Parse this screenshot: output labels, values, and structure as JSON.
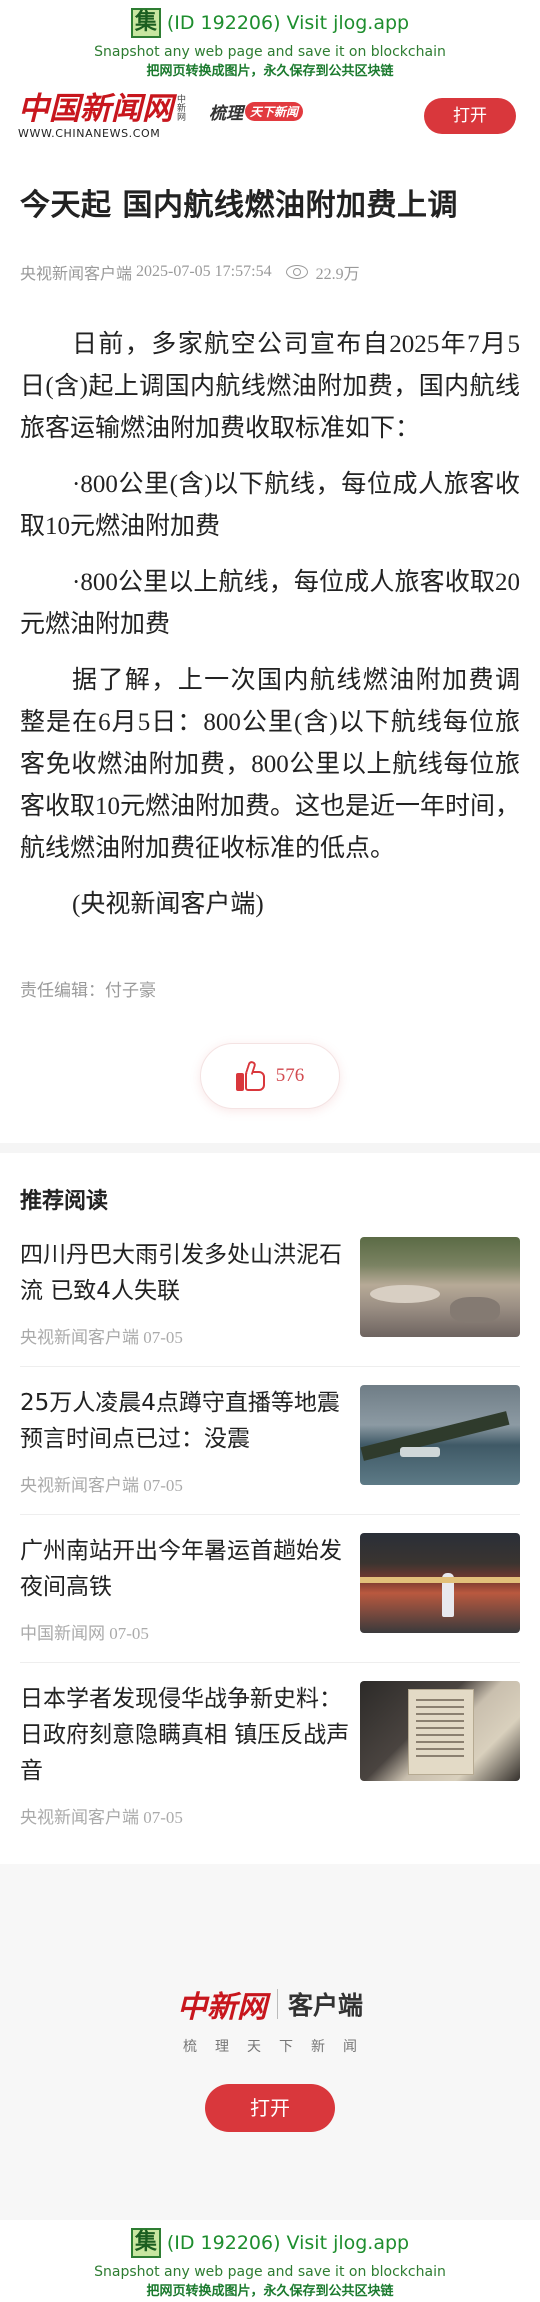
{
  "watermark": {
    "logo_char": "集",
    "id_text": "(ID 192206) Visit jlog.app",
    "line_en": "Snapshot any web page and save it on blockchain",
    "line_cn": "把网页转换成图片，永久保存到公共区块链"
  },
  "header": {
    "brand_cn": "中国新闻网",
    "brand_small": "中新网",
    "brand_url": "WWW.CHINANEWS.COM",
    "slogan_a": "梳理",
    "slogan_b": "天下新闻",
    "open_button": "打开"
  },
  "article": {
    "title": "今天起 国内航线燃油附加费上调",
    "source": "央视新闻客户端",
    "time": "2025-07-05 17:57:54",
    "views": "22.9万",
    "paragraphs": [
      "日前，多家航空公司宣布自2025年7月5日(含)起上调国内航线燃油附加费，国内航线旅客运输燃油附加费收取标准如下：",
      "·800公里(含)以下航线，每位成人旅客收取10元燃油附加费",
      "·800公里以上航线，每位成人旅客收取20元燃油附加费",
      "据了解，上一次国内航线燃油附加费调整是在6月5日：800公里(含)以下航线每位旅客免收燃油附加费，800公里以上航线每位旅客收取10元燃油附加费。这也是近一年时间，航线燃油附加费征收标准的低点。",
      "(央视新闻客户端)"
    ],
    "editor": "责任编辑：付子豪",
    "likes": "576"
  },
  "recommend": {
    "title": "推荐阅读",
    "items": [
      {
        "headline": "四川丹巴大雨引发多处山洪泥石流 已致4人失联",
        "source": "央视新闻客户端 07-05"
      },
      {
        "headline": "25万人凌晨4点蹲守直播等地震预言时间点已过：没震",
        "source": "央视新闻客户端 07-05"
      },
      {
        "headline": "广州南站开出今年暑运首趟始发夜间高铁",
        "source": "中国新闻网 07-05"
      },
      {
        "headline": "日本学者发现侵华战争新史料：日政府刻意隐瞒真相 镇压反战声音",
        "source": "央视新闻客户端 07-05"
      }
    ]
  },
  "footer": {
    "logo": "中新网",
    "client": "客户端",
    "slogan": "梳理天下新闻",
    "open_button": "打开"
  }
}
